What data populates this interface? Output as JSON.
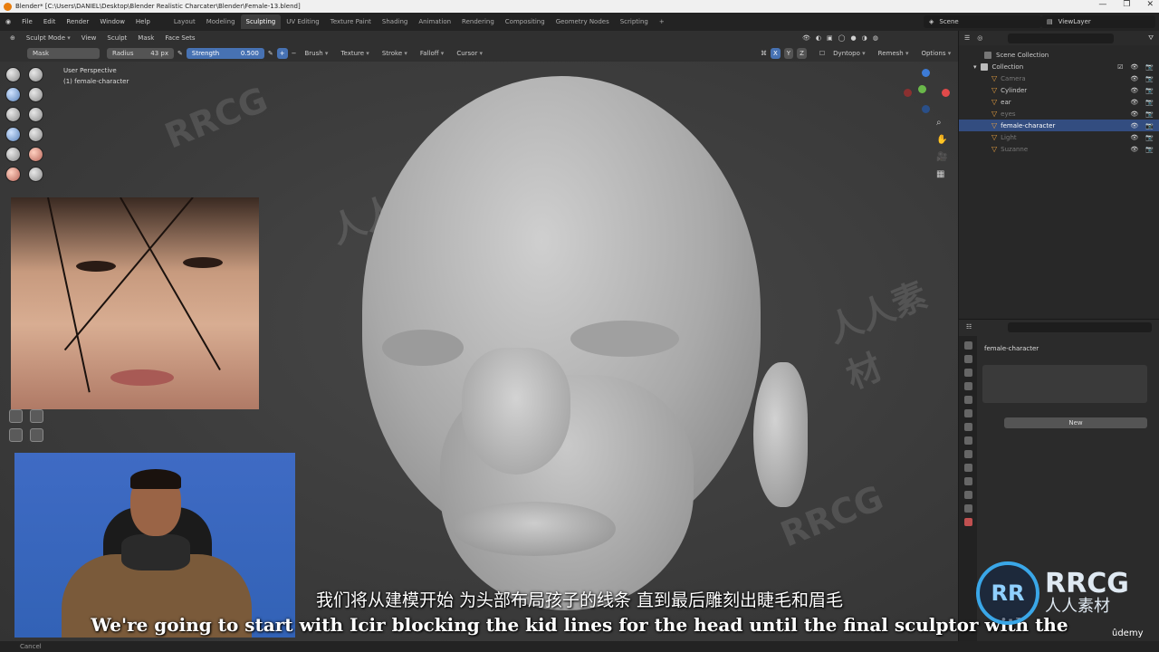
{
  "window": {
    "title": "Blender* [C:\\Users\\DANIEL\\Desktop\\Blender Realistic Charcater\\Blender\\Female-13.blend]",
    "controls": [
      "—",
      "❐",
      "✕"
    ]
  },
  "menu": [
    "File",
    "Edit",
    "Render",
    "Window",
    "Help"
  ],
  "workspaces": [
    "Layout",
    "Modeling",
    "Sculpting",
    "UV Editing",
    "Texture Paint",
    "Shading",
    "Animation",
    "Rendering",
    "Compositing",
    "Geometry Nodes",
    "Scripting",
    "+"
  ],
  "active_workspace": "Sculpting",
  "scene": "Scene",
  "view_layer": "ViewLayer",
  "header": {
    "mode": "Sculpt Mode",
    "menus": [
      "View",
      "Sculpt",
      "Mask",
      "Face Sets"
    ]
  },
  "tool_settings": {
    "brush_name": "Mask",
    "radius_label": "Radius",
    "radius_value": "43 px",
    "strength_label": "Strength",
    "strength_value": "0.500",
    "dropdowns": [
      "Brush",
      "Texture",
      "Stroke",
      "Falloff",
      "Cursor"
    ],
    "axes": [
      "X",
      "Y",
      "Z"
    ],
    "right_dropdowns": [
      "Dyntopo",
      "Remesh",
      "Options"
    ]
  },
  "viewport": {
    "perspective": "User Perspective",
    "object": "(1) female-character"
  },
  "outliner": {
    "root": "Scene Collection",
    "collection": "Collection",
    "items": [
      {
        "name": "Camera",
        "dim": true
      },
      {
        "name": "Cylinder",
        "dim": false
      },
      {
        "name": "ear",
        "dim": false
      },
      {
        "name": "eyes",
        "dim": true
      },
      {
        "name": "female-character",
        "dim": false,
        "selected": true
      },
      {
        "name": "Light",
        "dim": true
      },
      {
        "name": "Suzanne",
        "dim": true
      }
    ]
  },
  "properties": {
    "object_name": "female-character",
    "new_button": "New"
  },
  "subtitles": {
    "cn": "我们将从建模开始 为头部布局孩子的线条 直到最后雕刻出睫毛和眉毛",
    "en": "We're going to start with Icir blocking the kid lines for the head until the final sculptor with the"
  },
  "status": "Cancel",
  "watermark": {
    "logo_letters": "RR",
    "brand": "RRCG",
    "brand_cn": "人人素材",
    "udemy": "ûdemy"
  },
  "colors": {
    "accent": "#4772b3",
    "selected_row": "#334d80",
    "blender_orange": "#e87d0d"
  }
}
